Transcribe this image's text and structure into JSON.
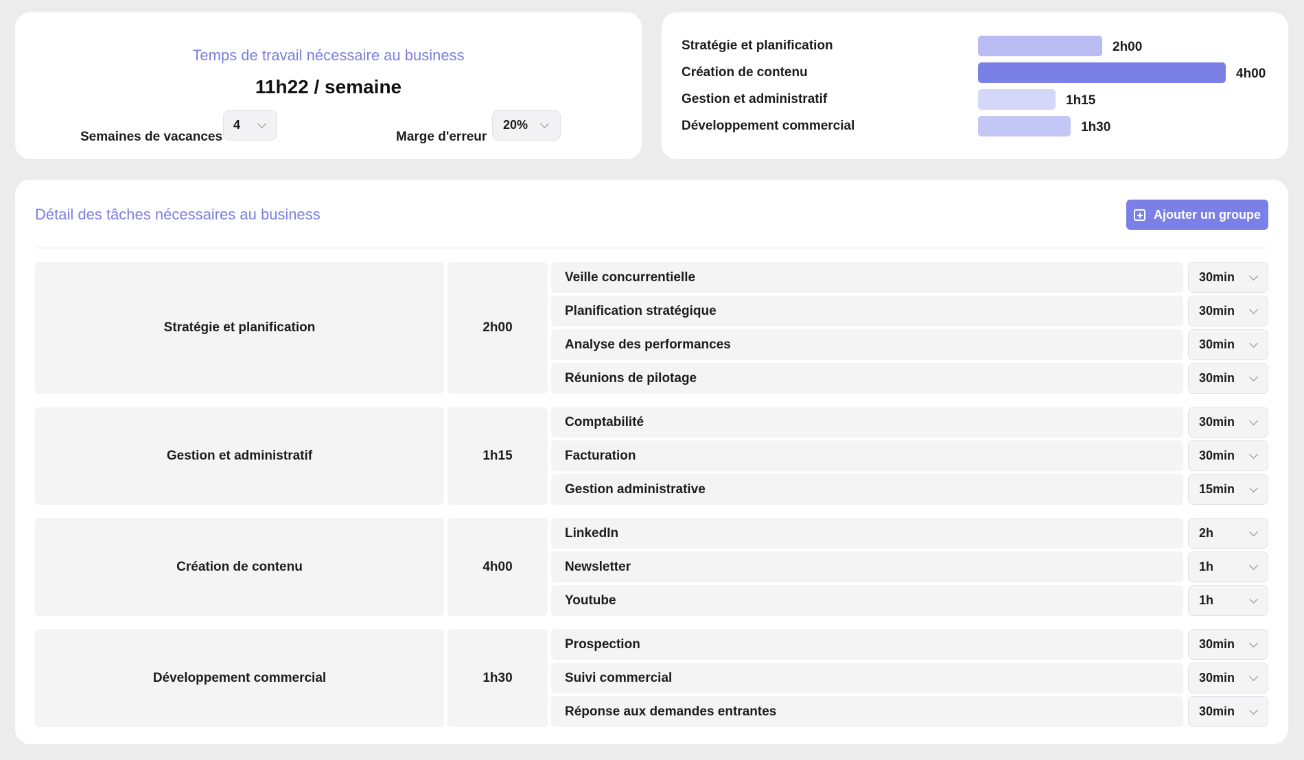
{
  "summary": {
    "title": "Temps de travail nécessaire au business",
    "total": "11h22 / semaine",
    "vacation_label": "Semaines de vacances",
    "vacation_value": "4",
    "margin_label": "Marge d'erreur",
    "margin_value": "20%"
  },
  "chart_data": {
    "type": "bar",
    "categories": [
      "Stratégie et planification",
      "Création de contenu",
      "Gestion et administratif",
      "Développement commercial"
    ],
    "values": [
      2.0,
      4.0,
      1.25,
      1.5
    ],
    "value_labels": [
      "2h00",
      "4h00",
      "1h15",
      "1h30"
    ],
    "colors": [
      "#b9bcf3",
      "#7b80e6",
      "#d5d7f8",
      "#c4c7f5"
    ],
    "xlabel": "",
    "ylabel": "",
    "orientation": "horizontal",
    "grid": false
  },
  "detail": {
    "title": "Détail des tâches nécessaires au business",
    "add_button_label": "Ajouter un groupe",
    "add_button_icon": "plus-square-icon",
    "accent_color": "#7b80e6",
    "groups": [
      {
        "name": "Stratégie et planification",
        "total": "2h00",
        "tasks": [
          {
            "name": "Veille concurrentielle",
            "duration": "30min"
          },
          {
            "name": "Planification stratégique",
            "duration": "30min"
          },
          {
            "name": "Analyse des performances",
            "duration": "30min"
          },
          {
            "name": "Réunions de pilotage",
            "duration": "30min"
          }
        ]
      },
      {
        "name": "Gestion et administratif",
        "total": "1h15",
        "tasks": [
          {
            "name": "Comptabilité",
            "duration": "30min"
          },
          {
            "name": "Facturation",
            "duration": "30min"
          },
          {
            "name": "Gestion administrative",
            "duration": "15min"
          }
        ]
      },
      {
        "name": "Création de contenu",
        "total": "4h00",
        "tasks": [
          {
            "name": "LinkedIn",
            "duration": "2h"
          },
          {
            "name": "Newsletter",
            "duration": "1h"
          },
          {
            "name": "Youtube",
            "duration": "1h"
          }
        ]
      },
      {
        "name": "Développement commercial",
        "total": "1h30",
        "tasks": [
          {
            "name": "Prospection",
            "duration": "30min"
          },
          {
            "name": "Suivi commercial",
            "duration": "30min"
          },
          {
            "name": "Réponse aux demandes entrantes",
            "duration": "30min"
          }
        ]
      }
    ]
  }
}
